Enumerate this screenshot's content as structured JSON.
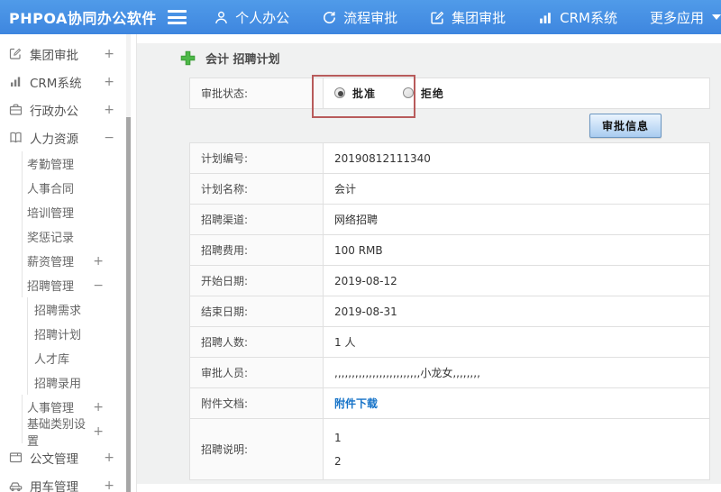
{
  "topbar": {
    "logo": "PHPOA协同办公软件",
    "items": [
      {
        "id": "personal-office",
        "label": "个人办公",
        "icon": "person-icon"
      },
      {
        "id": "workflow-approval",
        "label": "流程审批",
        "icon": "history-icon"
      },
      {
        "id": "group-approval",
        "label": "集团审批",
        "icon": "edit-icon"
      },
      {
        "id": "crm-system",
        "label": "CRM系统",
        "icon": "bar-chart-icon"
      },
      {
        "id": "more-apps",
        "label": "更多应用",
        "icon": "caret-down-icon"
      }
    ]
  },
  "sidebar": {
    "items": [
      {
        "id": "group-approval",
        "label": "集团审批",
        "icon": "edit-square-icon",
        "level": 1,
        "toggle": "+"
      },
      {
        "id": "crm-system",
        "label": "CRM系统",
        "icon": "bar-chart-icon",
        "level": 1,
        "toggle": "+"
      },
      {
        "id": "admin-office",
        "label": "行政办公",
        "icon": "briefcase-icon",
        "level": 1,
        "toggle": "+"
      },
      {
        "id": "human-resources",
        "label": "人力资源",
        "icon": "book-icon",
        "level": 1,
        "toggle": "−"
      },
      {
        "id": "attendance-mgmt",
        "label": "考勤管理",
        "level": 2,
        "toggle": ""
      },
      {
        "id": "hr-contract",
        "label": "人事合同",
        "level": 2,
        "toggle": ""
      },
      {
        "id": "training-mgmt",
        "label": "培训管理",
        "level": 2,
        "toggle": ""
      },
      {
        "id": "reward-punish-record",
        "label": "奖惩记录",
        "level": 2,
        "toggle": ""
      },
      {
        "id": "salary-mgmt",
        "label": "薪资管理",
        "level": 2,
        "toggle": "+"
      },
      {
        "id": "recruit-mgmt",
        "label": "招聘管理",
        "level": 2,
        "toggle": "−"
      },
      {
        "id": "recruit-demand",
        "label": "招聘需求",
        "level": 3,
        "toggle": ""
      },
      {
        "id": "recruit-plan",
        "label": "招聘计划",
        "level": 3,
        "toggle": ""
      },
      {
        "id": "talent-pool",
        "label": "人才库",
        "level": 3,
        "toggle": ""
      },
      {
        "id": "recruit-hire",
        "label": "招聘录用",
        "level": 3,
        "toggle": ""
      },
      {
        "id": "personnel-mgmt",
        "label": "人事管理",
        "level": 2,
        "toggle": "+"
      },
      {
        "id": "base-category-settings",
        "label": "基础类别设置",
        "level": 2,
        "toggle": "+"
      },
      {
        "id": "document-mgmt",
        "label": "公文管理",
        "icon": "document-icon",
        "level": 1,
        "toggle": "+"
      },
      {
        "id": "vehicle-mgmt",
        "label": "用车管理",
        "icon": "car-icon",
        "level": 1,
        "toggle": "+"
      }
    ]
  },
  "main": {
    "title": "会计 招聘计划",
    "approval": {
      "status_label": "审批状态:",
      "options": [
        {
          "label": "批准",
          "selected": true
        },
        {
          "label": "拒绝",
          "selected": false
        }
      ],
      "info_button": "审批信息"
    },
    "fields": [
      {
        "id": "plan-no",
        "label": "计划编号:",
        "value": "20190812111340"
      },
      {
        "id": "plan-name",
        "label": "计划名称:",
        "value": "会计"
      },
      {
        "id": "recruit-channel",
        "label": "招聘渠道:",
        "value": "网络招聘"
      },
      {
        "id": "recruit-cost",
        "label": "招聘费用:",
        "value": "100 RMB"
      },
      {
        "id": "start-date",
        "label": "开始日期:",
        "value": "2019-08-12"
      },
      {
        "id": "end-date",
        "label": "结束日期:",
        "value": "2019-08-31"
      },
      {
        "id": "recruit-count",
        "label": "招聘人数:",
        "value": "1 人"
      },
      {
        "id": "approvers",
        "label": "审批人员:",
        "value": ",,,,,,,,,,,,,,,,,,,,,,,,,小龙女,,,,,,,,"
      },
      {
        "id": "attachment",
        "label": "附件文档:",
        "value": "附件下载",
        "link": true
      },
      {
        "id": "recruit-desc",
        "label": "招聘说明:",
        "lines": [
          "1",
          "2"
        ],
        "tall": true
      }
    ]
  },
  "colors": {
    "topbar_blue": "#4693e5",
    "content_bg": "#f0f1f1",
    "annotation_red": "#b85b5b",
    "link_blue": "#1673c8",
    "plus_green": "#4db848",
    "button_face": "#a9ccf0",
    "button_border": "#6b96c1"
  }
}
